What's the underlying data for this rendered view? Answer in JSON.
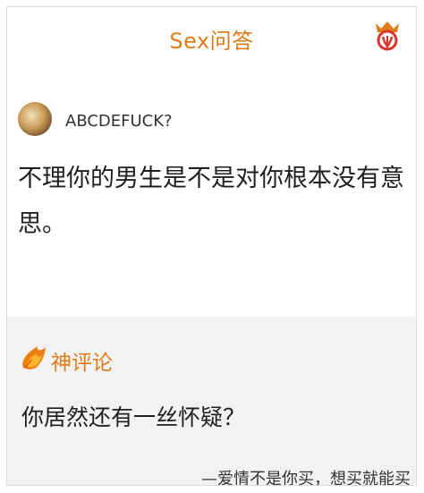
{
  "header": {
    "title": "Sex问答",
    "logo_icon": "crown-logo-icon",
    "accent_color": "#e07b1a"
  },
  "post": {
    "asker_name": "ABCDEFUCK?",
    "question": "不理你的男生是不是对你根本没有意思。"
  },
  "god_comment": {
    "label": "神评论",
    "icon": "fire-icon",
    "text": "你居然还有一丝怀疑？"
  },
  "footer": {
    "signature": "—爱情不是你买，想买就能买"
  }
}
